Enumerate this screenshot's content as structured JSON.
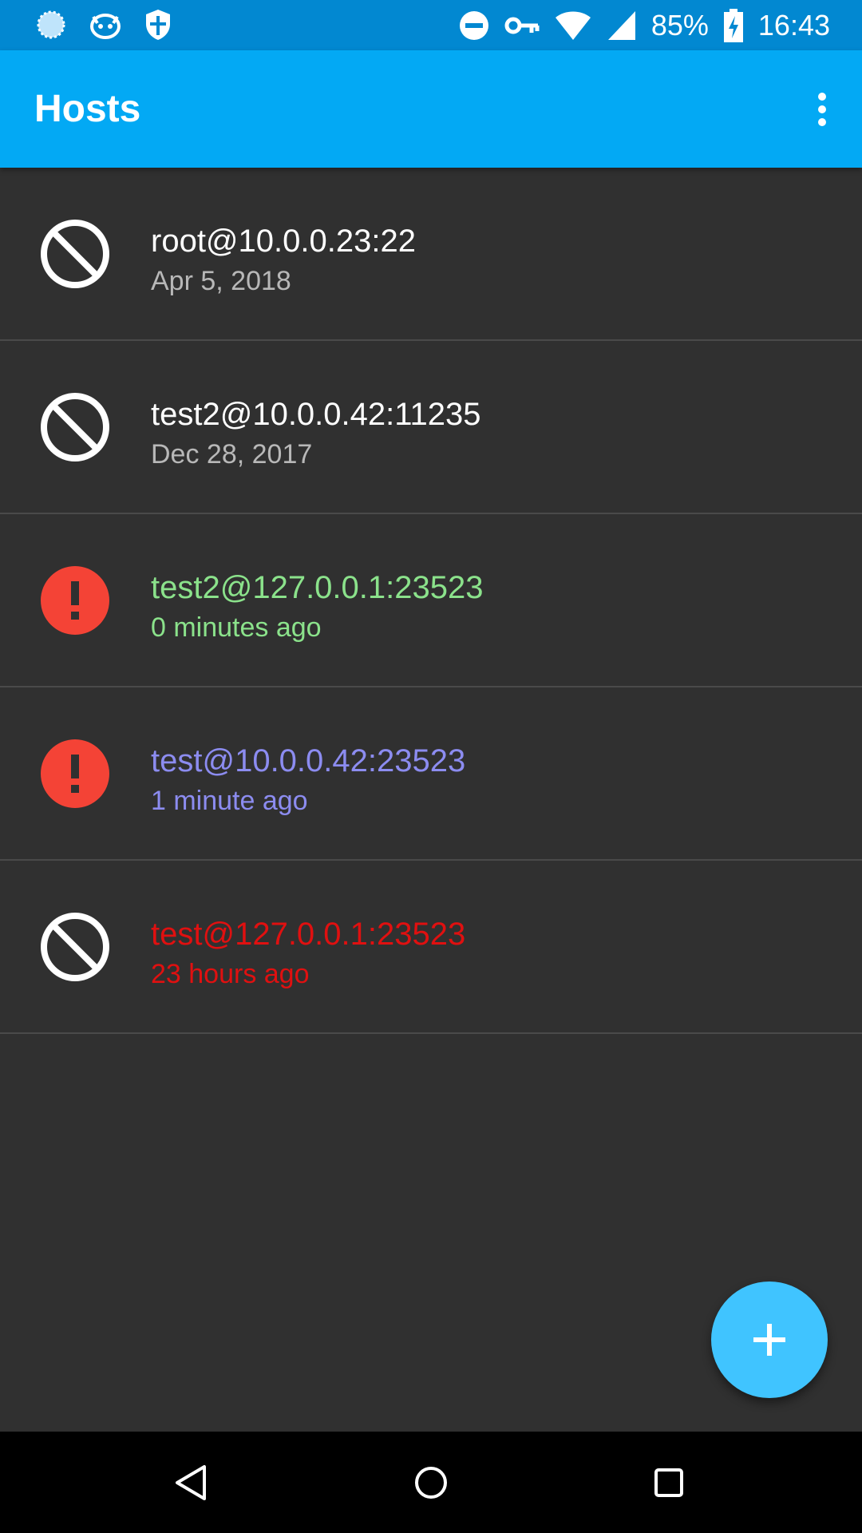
{
  "status_bar": {
    "battery_percent": "85%",
    "time": "16:43",
    "icons": [
      "loading-circle-icon",
      "cat-face-icon",
      "shield-icon",
      "do-not-disturb-icon",
      "vpn-key-icon",
      "wifi-icon",
      "cell-signal-icon",
      "battery-charging-icon"
    ]
  },
  "app_bar": {
    "title": "Hosts",
    "overflow_icon": "more-vert-icon"
  },
  "hosts": [
    {
      "title": "root@10.0.0.23:22",
      "subtitle": "Apr 5, 2018",
      "status_icon": "block-icon",
      "color": "#ffffff",
      "sub_color": "#b8b8b8"
    },
    {
      "title": "test2@10.0.0.42:11235",
      "subtitle": "Dec 28, 2017",
      "status_icon": "block-icon",
      "color": "#ffffff",
      "sub_color": "#b8b8b8"
    },
    {
      "title": "test2@127.0.0.1:23523",
      "subtitle": "0 minutes ago",
      "status_icon": "error-icon",
      "color": "#8be28b",
      "sub_color": "#8be28b"
    },
    {
      "title": "test@10.0.0.42:23523",
      "subtitle": "1 minute ago",
      "status_icon": "error-icon",
      "color": "#8c8cf0",
      "sub_color": "#8c8cf0"
    },
    {
      "title": "test@127.0.0.1:23523",
      "subtitle": "23 hours ago",
      "status_icon": "block-icon",
      "color": "#e01010",
      "sub_color": "#e01010"
    }
  ],
  "fab": {
    "icon": "add-icon",
    "color": "#40c4ff"
  },
  "colors": {
    "app_bar": "#03a9f4",
    "status_bar": "#0288d1",
    "background": "#303030",
    "error": "#f44336"
  },
  "nav_bar": {
    "icons": [
      "back-icon",
      "home-icon",
      "recents-icon"
    ]
  }
}
